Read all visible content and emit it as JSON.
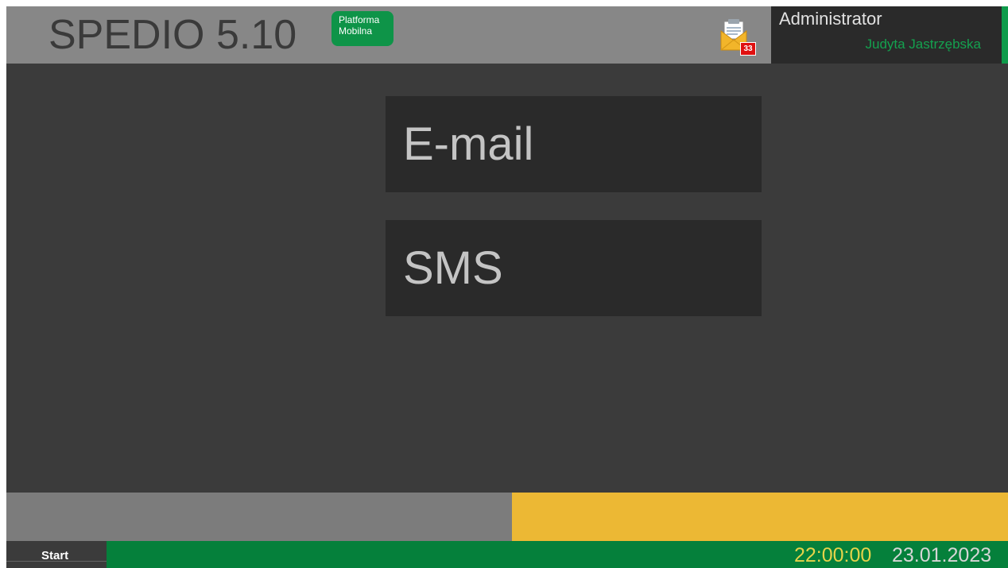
{
  "header": {
    "app_title": "SPEDIO 5.10",
    "platform_badge": {
      "line1": "Platforma",
      "line2": "Mobilna"
    },
    "mail": {
      "icon": "mail-envelope-icon",
      "unread_count": "33"
    },
    "user": {
      "role": "Administrator",
      "name": "Judyta Jastrzębska"
    }
  },
  "main": {
    "buttons": [
      {
        "label": "E-mail"
      },
      {
        "label": "SMS"
      }
    ]
  },
  "taskbar": {
    "start_label": "Start",
    "time": "22:00:00",
    "date": "23.01.2023"
  },
  "colors": {
    "background": "#3b3b3b",
    "header": "#878787",
    "accent_green": "#0f9b4b",
    "status_yellow": "#ecb834",
    "clock_yellow": "#e6d34a"
  }
}
